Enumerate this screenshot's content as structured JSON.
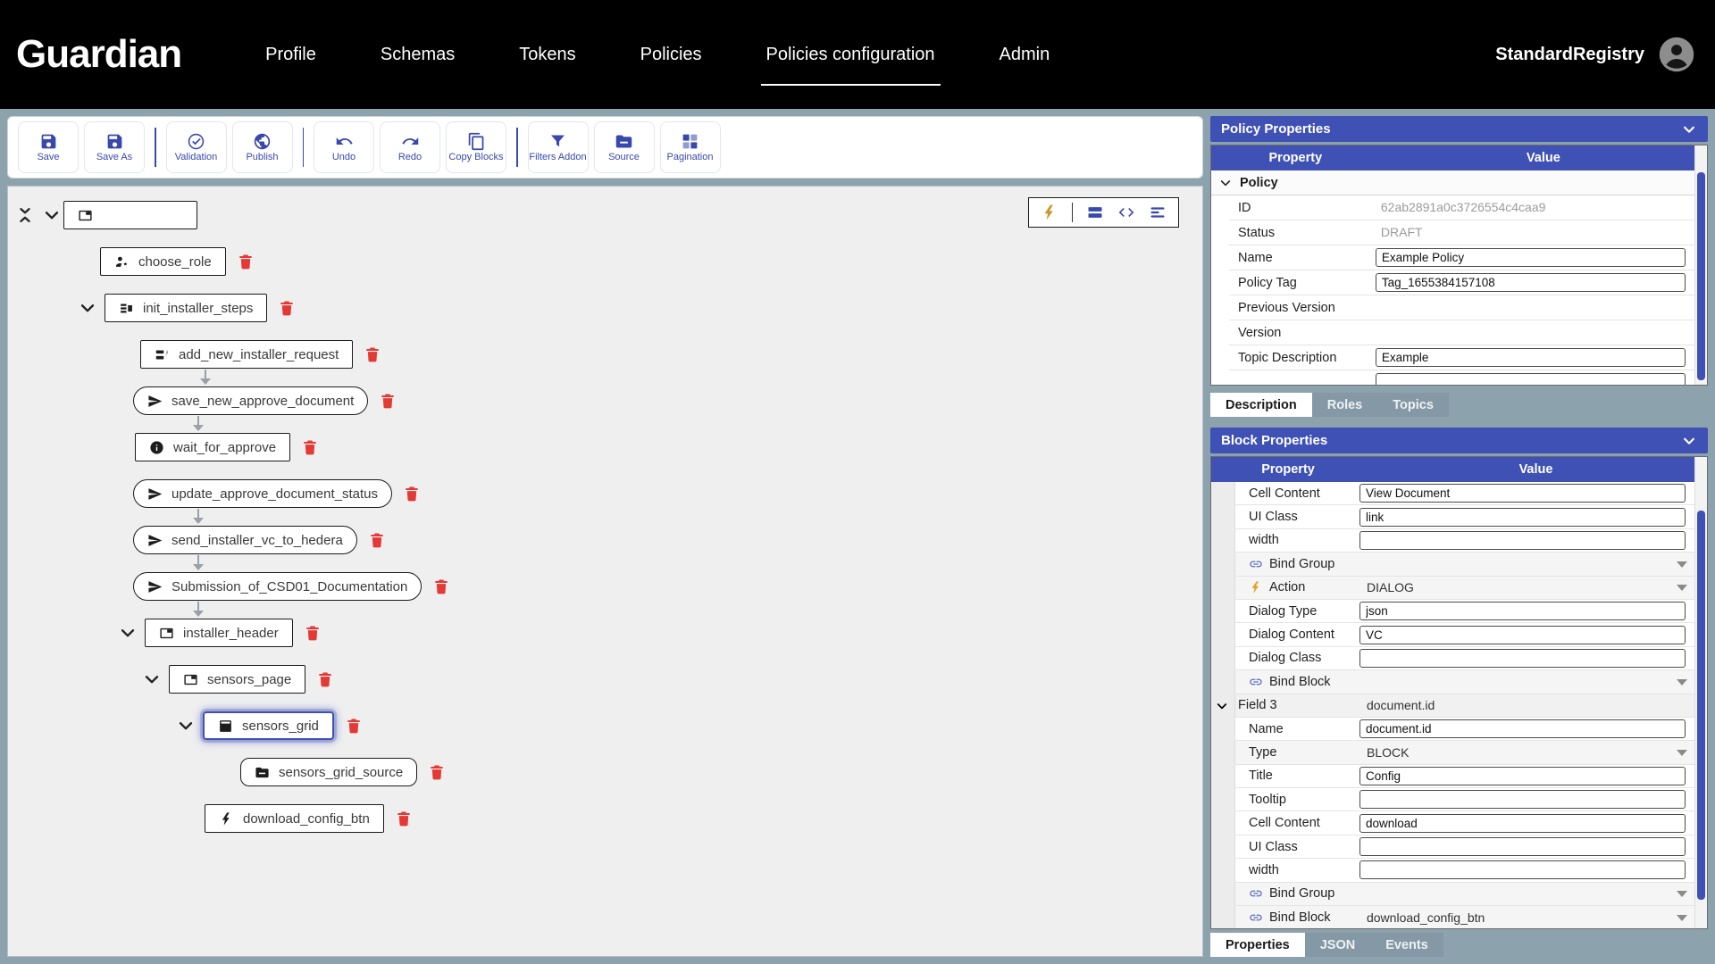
{
  "nav": {
    "brand": "Guardian",
    "items": [
      {
        "label": "Profile",
        "active": false
      },
      {
        "label": "Schemas",
        "active": false
      },
      {
        "label": "Tokens",
        "active": false
      },
      {
        "label": "Policies",
        "active": false
      },
      {
        "label": "Policies configuration",
        "active": true
      },
      {
        "label": "Admin",
        "active": false
      }
    ],
    "user": "StandardRegistry"
  },
  "toolbar": {
    "groups": [
      [
        {
          "label": "Save",
          "icon": "save"
        },
        {
          "label": "Save As",
          "icon": "save"
        }
      ],
      [
        {
          "label": "Validation",
          "icon": "check-circle"
        },
        {
          "label": "Publish",
          "icon": "globe"
        }
      ],
      [
        {
          "label": "Undo",
          "icon": "undo"
        },
        {
          "label": "Redo",
          "icon": "redo"
        },
        {
          "label": "Copy Blocks",
          "icon": "copy"
        }
      ],
      [
        {
          "label": "Filters Addon",
          "icon": "filter"
        },
        {
          "label": "Source",
          "icon": "folder"
        },
        {
          "label": "Pagination",
          "icon": "pagination"
        }
      ]
    ]
  },
  "canvas": {
    "mini_toolbar": {
      "icons": [
        "bolt",
        "blocks-view",
        "code",
        "tree-view"
      ]
    },
    "tree": [
      {
        "label": "",
        "icon": "tab",
        "shape": "rect",
        "ml": 62,
        "root": true
      },
      {
        "label": "choose_role",
        "icon": "person-gear",
        "shape": "rect",
        "ml": 103
      },
      {
        "label": "init_installer_steps",
        "icon": "steps",
        "shape": "rect",
        "ml": 108,
        "chevron": true
      },
      {
        "label": "add_new_installer_request",
        "icon": "request",
        "shape": "rect",
        "ml": 148
      },
      {
        "label": "save_new_approve_document",
        "icon": "send",
        "shape": "pill",
        "ml": 140,
        "arrow": true,
        "arrow_ml": 210
      },
      {
        "label": "wait_for_approve",
        "icon": "info",
        "shape": "rect",
        "ml": 142,
        "arrow": true,
        "arrow_ml": 202
      },
      {
        "label": "update_approve_document_status",
        "icon": "send",
        "shape": "pill",
        "ml": 140
      },
      {
        "label": "send_installer_vc_to_hedera",
        "icon": "send",
        "shape": "pill",
        "ml": 140,
        "arrow": true,
        "arrow_ml": 202
      },
      {
        "label": "Submission_of_CSD01_Documentation",
        "icon": "send",
        "shape": "pill",
        "ml": 140,
        "arrow": true,
        "arrow_ml": 202
      },
      {
        "label": "installer_header",
        "icon": "tab",
        "shape": "rect",
        "ml": 153,
        "chevron": true,
        "arrow": true,
        "arrow_ml": 202
      },
      {
        "label": "sensors_page",
        "icon": "tab",
        "shape": "rect",
        "ml": 180,
        "chevron": true
      },
      {
        "label": "sensors_grid",
        "icon": "grid",
        "shape": "rect",
        "ml": 218,
        "chevron": true,
        "selected": true
      },
      {
        "label": "sensors_grid_source",
        "icon": "folder",
        "shape": "round",
        "ml": 260
      },
      {
        "label": "download_config_btn",
        "icon": "bolt",
        "shape": "rect",
        "ml": 220
      }
    ]
  },
  "policy_properties": {
    "title": "Policy Properties",
    "columns": [
      "Property",
      "Value"
    ],
    "group": "Policy",
    "rows": [
      {
        "label": "ID",
        "value": "62ab2891a0c3726554c4caa9",
        "kind": "readonly"
      },
      {
        "label": "Status",
        "value": "DRAFT",
        "kind": "readonly"
      },
      {
        "label": "Name",
        "value": "Example Policy",
        "kind": "input"
      },
      {
        "label": "Policy Tag",
        "value": "Tag_1655384157108",
        "kind": "input"
      },
      {
        "label": "Previous Version",
        "value": "",
        "kind": "blank"
      },
      {
        "label": "Version",
        "value": "",
        "kind": "blank"
      },
      {
        "label": "Topic Description",
        "value": "Example",
        "kind": "input"
      },
      {
        "label": "",
        "value": "",
        "kind": "input"
      }
    ]
  },
  "panel_tabs": [
    {
      "label": "Description",
      "active": true
    },
    {
      "label": "Roles",
      "active": false
    },
    {
      "label": "Topics",
      "active": false
    }
  ],
  "block_properties": {
    "title": "Block Properties",
    "columns": [
      "Property",
      "Value"
    ],
    "rows": [
      {
        "label": "Cell Content",
        "value": "View Document",
        "kind": "input"
      },
      {
        "label": "UI Class",
        "value": "link",
        "kind": "input"
      },
      {
        "label": "width",
        "value": "",
        "kind": "input"
      },
      {
        "label": "Bind Group",
        "value": "",
        "kind": "select",
        "icon": "link"
      },
      {
        "label": "Action",
        "value": "DIALOG",
        "kind": "select",
        "icon": "bolt"
      },
      {
        "label": "Dialog Type",
        "value": "json",
        "kind": "input"
      },
      {
        "label": "Dialog Content",
        "value": "VC",
        "kind": "input"
      },
      {
        "label": "Dialog Class",
        "value": "",
        "kind": "input"
      },
      {
        "label": "Bind Block",
        "value": "",
        "kind": "select",
        "icon": "link"
      },
      {
        "label": "Field 3",
        "value": "document.id",
        "kind": "group"
      },
      {
        "label": "Name",
        "value": "document.id",
        "kind": "input"
      },
      {
        "label": "Type",
        "value": "BLOCK",
        "kind": "select"
      },
      {
        "label": "Title",
        "value": "Config",
        "kind": "input"
      },
      {
        "label": "Tooltip",
        "value": "",
        "kind": "input"
      },
      {
        "label": "Cell Content",
        "value": "download",
        "kind": "input"
      },
      {
        "label": "UI Class",
        "value": "",
        "kind": "input"
      },
      {
        "label": "width",
        "value": "",
        "kind": "input"
      },
      {
        "label": "Bind Group",
        "value": "",
        "kind": "select",
        "icon": "link"
      },
      {
        "label": "Bind Block",
        "value": "download_config_btn",
        "kind": "select",
        "icon": "link"
      }
    ]
  },
  "bottom_tabs": [
    {
      "label": "Properties",
      "active": true
    },
    {
      "label": "JSON",
      "active": false
    },
    {
      "label": "Events",
      "active": false
    }
  ],
  "colors": {
    "accent": "#3f51b5",
    "toolbar_icon": "#3949ab",
    "danger": "#e53935",
    "bolt_gold": "#c9962b",
    "link_icon": "#5c6bc0",
    "background": "#8ca2ad"
  }
}
